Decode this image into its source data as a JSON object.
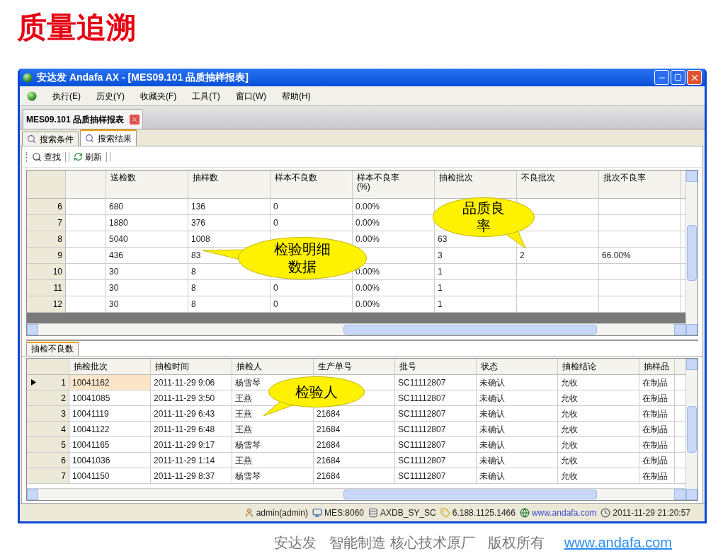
{
  "page_title": "质量追溯",
  "window": {
    "title": "安达发 Andafa AX - [MES09.101 品质抽样报表]"
  },
  "menu": [
    "执行(E)",
    "历史(Y)",
    "收藏夹(F)",
    "工具(T)",
    "窗口(W)",
    "帮助(H)"
  ],
  "doc_tab": {
    "label": "MES09.101 品质抽样报表"
  },
  "tabs": [
    {
      "label": "搜索条件",
      "selected": false
    },
    {
      "label": "搜索结果",
      "selected": true
    }
  ],
  "toolbar": [
    {
      "kind": "find",
      "label": "查找"
    },
    {
      "kind": "refresh",
      "label": "刷新"
    }
  ],
  "top_table": {
    "columns": [
      "送检数",
      "抽样数",
      "样本不良数",
      "样本不良率\n(%)",
      "抽检批次",
      "不良批次",
      "批次不良率"
    ],
    "rows": [
      {
        "index": "6",
        "cells": [
          "680",
          "136",
          "0",
          "0.00%",
          null,
          null,
          null
        ]
      },
      {
        "index": "7",
        "cells": [
          "1880",
          "376",
          "0",
          "0.00%",
          null,
          null,
          null
        ]
      },
      {
        "index": "8",
        "cells": [
          "5040",
          "1008",
          null,
          "0.00%",
          "63",
          null,
          null
        ]
      },
      {
        "index": "9",
        "cells": [
          "436",
          "83",
          null,
          null,
          "3",
          "2",
          "66.00%"
        ]
      },
      {
        "index": "10",
        "cells": [
          "30",
          "8",
          null,
          "0.00%",
          "1",
          null,
          null
        ]
      },
      {
        "index": "11",
        "cells": [
          "30",
          "8",
          "0",
          "0.00%",
          "1",
          null,
          null
        ]
      },
      {
        "index": "12",
        "cells": [
          "30",
          "8",
          "0",
          "0.00%",
          "1",
          null,
          null
        ]
      }
    ]
  },
  "bottom_tab": {
    "label": "抽检不良数"
  },
  "bottom_table": {
    "columns": [
      "抽检批次",
      "抽检时间",
      "抽检人",
      "生产单号",
      "批号",
      "状态",
      "抽检结论",
      "抽样品"
    ],
    "rows": [
      {
        "index": "1",
        "selected": true,
        "cells": [
          "10041162",
          "2011-11-29 9:06",
          "杨雪琴",
          null,
          "SC11112807",
          "未确认",
          "允收",
          "在制品"
        ]
      },
      {
        "index": "2",
        "selected": false,
        "cells": [
          "10041085",
          "2011-11-29 3:50",
          "王燕",
          null,
          "SC11112807",
          "未确认",
          "允收",
          "在制品"
        ]
      },
      {
        "index": "3",
        "selected": false,
        "cells": [
          "10041119",
          "2011-11-29 6:43",
          "王燕",
          "21684",
          "SC11112807",
          "未确认",
          "允收",
          "在制品"
        ]
      },
      {
        "index": "4",
        "selected": false,
        "cells": [
          "10041122",
          "2011-11-29 6:48",
          "王燕",
          "21684",
          "SC11112807",
          "未确认",
          "允收",
          "在制品"
        ]
      },
      {
        "index": "5",
        "selected": false,
        "cells": [
          "10041165",
          "2011-11-29 9:17",
          "杨雪琴",
          "21684",
          "SC11112807",
          "未确认",
          "允收",
          "在制品"
        ]
      },
      {
        "index": "6",
        "selected": false,
        "cells": [
          "10041036",
          "2011-11-29 1:14",
          "王燕",
          "21684",
          "SC11112807",
          "未确认",
          "允收",
          "在制品"
        ]
      },
      {
        "index": "7",
        "selected": false,
        "cells": [
          "10041150",
          "2011-11-29 8:37",
          "杨雪琴",
          "21684",
          "SC11112807",
          "未确认",
          "允收",
          "在制品"
        ]
      }
    ]
  },
  "callouts": [
    {
      "text": "检验明细数据"
    },
    {
      "text": "品质良率"
    },
    {
      "text": "检验人"
    }
  ],
  "status_bar": [
    {
      "kind": "user",
      "text": "admin(admin)"
    },
    {
      "kind": "server",
      "text": "MES:8060"
    },
    {
      "kind": "db",
      "text": "AXDB_SY_SC"
    },
    {
      "kind": "version",
      "text": "6.188.1125.1466"
    },
    {
      "kind": "web",
      "text": "www.andafa.com"
    },
    {
      "kind": "time",
      "text": "2011-11-29 21:20:57"
    }
  ],
  "footer": {
    "company": "安达发",
    "slogan": "智能制造 核心技术原厂",
    "rights": "版权所有",
    "link": "www.andafa.com"
  }
}
